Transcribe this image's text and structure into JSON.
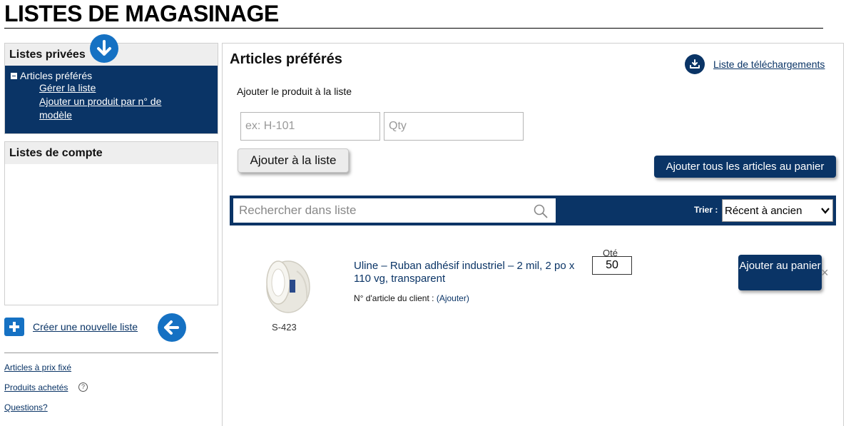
{
  "page": {
    "title": "LISTES DE MAGASINAGE"
  },
  "sidebar": {
    "private_heading": "Listes privées",
    "favorites_label": "Articles préférés",
    "links": [
      "Gérer la liste",
      "Ajouter un produit par n° de modèle"
    ],
    "account_heading": "Listes de compte",
    "create_list": "Créer une nouvelle liste",
    "footer_links": [
      "Articles à prix fixé",
      "Produits achetés",
      "Questions?"
    ],
    "help_glyph": "?"
  },
  "main": {
    "title": "Articles préférés",
    "download_link": "Liste de téléchargements",
    "add_label": "Ajouter le produit à la liste",
    "model_placeholder": "ex: H-101",
    "qty_placeholder": "Qty",
    "add_button": "Ajouter à la liste",
    "add_all_button": "Ajouter tous les articles au panier",
    "search_placeholder": "Rechercher dans liste",
    "sort_label": "Trier :",
    "sort_selected": "Récent à ancien"
  },
  "item": {
    "sku": "S-423",
    "name": "Uline – Ruban adhésif industriel – 2 mil, 2 po x 110 vg, transparent",
    "customer_label": "N° d'article du client :",
    "customer_action": "(Ajouter)",
    "qty_label": "Qté",
    "qty_value": "50",
    "add_cart_button": "Ajouter au panier",
    "remove_glyph": "×"
  },
  "colors": {
    "navy": "#0a3466",
    "accent_blue": "#1571c3"
  },
  "icons": [
    "arrow-down-icon",
    "arrow-left-icon",
    "plus-icon",
    "download-icon",
    "search-icon",
    "help-icon",
    "close-icon"
  ]
}
